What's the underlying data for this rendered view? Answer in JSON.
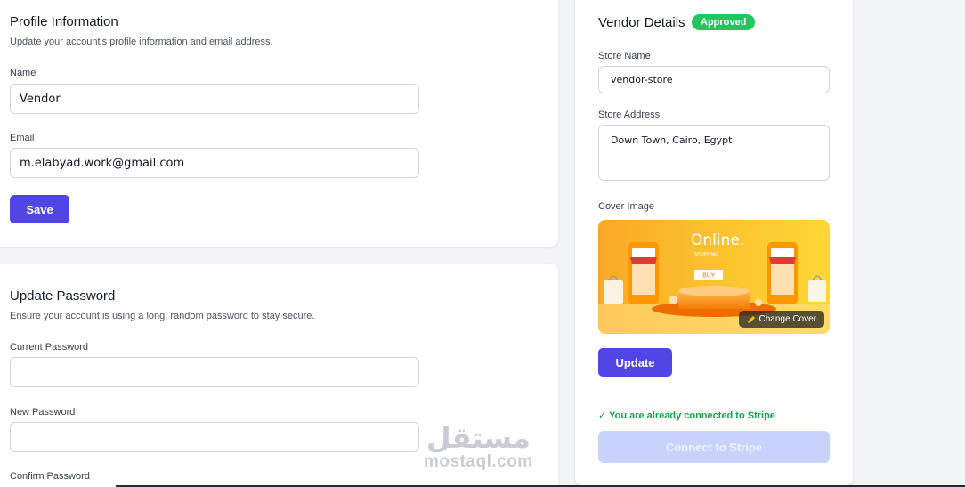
{
  "profile": {
    "title": "Profile Information",
    "description": "Update your account's profile information and email address.",
    "name_label": "Name",
    "name_value": "Vendor",
    "email_label": "Email",
    "email_value": "m.elabyad.work@gmail.com",
    "save_label": "Save"
  },
  "password": {
    "title": "Update Password",
    "description": "Ensure your account is using a long, random password to stay secure.",
    "current_label": "Current Password",
    "new_label": "New Password",
    "confirm_label": "Confirm Password"
  },
  "vendor": {
    "title": "Vendor Details",
    "status_badge": "Approved",
    "store_name_label": "Store Name",
    "store_name_value": "vendor-store",
    "store_address_label": "Store Address",
    "store_address_value": "Down Town, Cairo, Egypt",
    "cover_label": "Cover Image",
    "cover_art": {
      "headline": "Online.",
      "sub": "SHOPPING",
      "button": "BUY"
    },
    "change_cover_label": "Change Cover",
    "update_label": "Update",
    "stripe_message": "✓ You are already connected to Stripe",
    "connect_stripe_label": "Connect to Stripe"
  },
  "watermark": {
    "arabic": "مستقل",
    "latin": "mostaql.com"
  },
  "colors": {
    "primary": "#4f46e5",
    "success": "#22c55e",
    "disabled": "#c7d2fe",
    "background": "#f3f4f6"
  }
}
